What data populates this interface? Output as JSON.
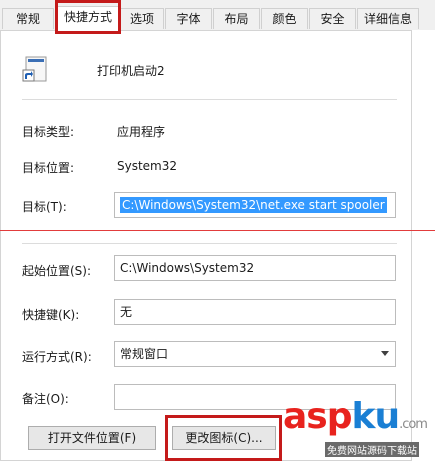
{
  "tabs": [
    {
      "label": "常规",
      "active": false
    },
    {
      "label": "快捷方式",
      "active": true
    },
    {
      "label": "选项",
      "active": false
    },
    {
      "label": "字体",
      "active": false
    },
    {
      "label": "布局",
      "active": false
    },
    {
      "label": "颜色",
      "active": false
    },
    {
      "label": "安全",
      "active": false
    },
    {
      "label": "详细信息",
      "active": false
    }
  ],
  "shortcut_name": "打印机启动2",
  "info": {
    "target_type_label": "目标类型:",
    "target_type_value": "应用程序",
    "target_location_label": "目标位置:",
    "target_location_value": "System32"
  },
  "fields": {
    "target_label": "目标(T):",
    "target_value": "C:\\Windows\\System32\\net.exe start spooler",
    "start_in_label": "起始位置(S):",
    "start_in_value": "C:\\Windows\\System32",
    "hotkey_label": "快捷键(K):",
    "hotkey_value": "无",
    "run_label": "运行方式(R):",
    "run_value": "常规窗口",
    "comment_label": "备注(O):",
    "comment_value": ""
  },
  "buttons": {
    "open_location": "打开文件位置(F)",
    "change_icon": "更改图标(C)..."
  },
  "watermark": {
    "brand_a": "asp",
    "brand_b": "ku",
    "brand_c": ".com",
    "tagline": "免费网站源码下载站"
  },
  "colors": {
    "highlight_red": "#c41a1a",
    "selection_blue": "#3399ff",
    "wm_red": "#e8231e",
    "wm_blue": "#1a7fd4"
  }
}
